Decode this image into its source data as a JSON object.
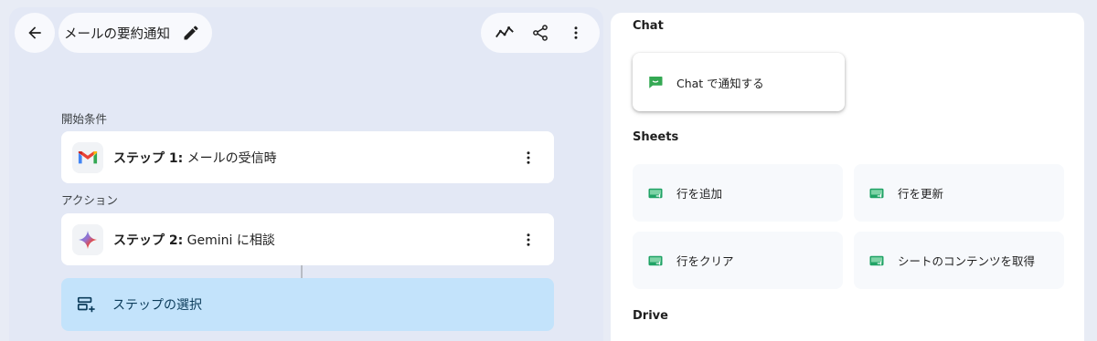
{
  "header": {
    "title": "メールの要約通知",
    "back_icon": "arrow-left-icon",
    "edit_icon": "pencil-icon",
    "tools": [
      "activity-icon",
      "share-icon",
      "more-vert-icon"
    ]
  },
  "flow": {
    "trigger_label": "開始条件",
    "trigger_step": {
      "prefix": "ステップ 1:",
      "text": "メールの受信時",
      "icon": "gmail-icon"
    },
    "action_label": "アクション",
    "action_step": {
      "prefix": "ステップ 2:",
      "text": "Gemini に相談",
      "icon": "gemini-icon"
    },
    "select_step_label": "ステップの選択"
  },
  "panel": {
    "chat_heading": "Chat",
    "chat_actions": [
      {
        "label": "Chat で通知する",
        "icon": "chat-icon"
      }
    ],
    "sheets_heading": "Sheets",
    "sheets_actions": [
      {
        "label": "行を追加",
        "icon": "sheets-icon"
      },
      {
        "label": "行を更新",
        "icon": "sheets-icon"
      },
      {
        "label": "行をクリア",
        "icon": "sheets-icon"
      },
      {
        "label": "シートのコンテンツを取得",
        "icon": "sheets-icon"
      }
    ],
    "drive_heading": "Drive"
  },
  "colors": {
    "canvas_bg": "#e3e8f5",
    "select_card_bg": "#c3e3fb",
    "sheets_green": "#21a366",
    "chat_green": "#34a853"
  }
}
